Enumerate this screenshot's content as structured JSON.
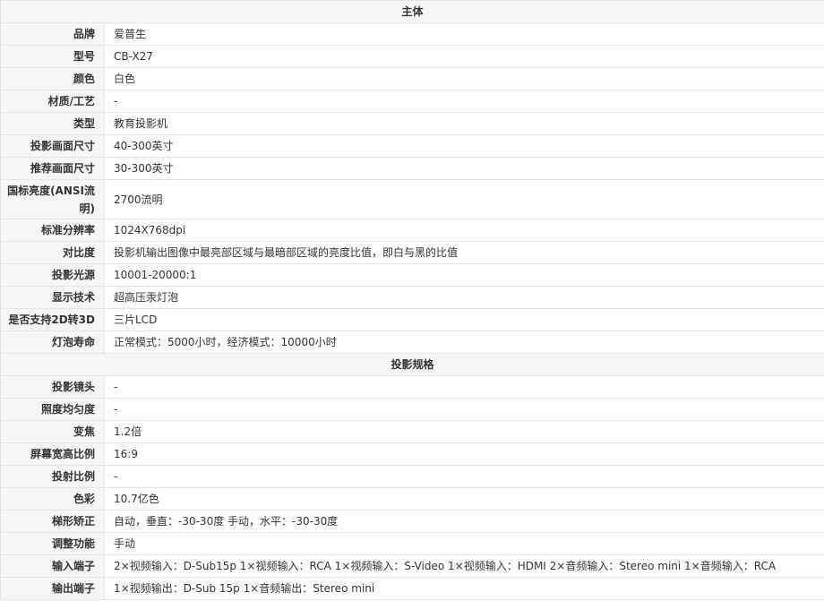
{
  "sections": [
    {
      "title": "主体",
      "rows": [
        {
          "label": "品牌",
          "value": "爱普生"
        },
        {
          "label": "型号",
          "value": "CB-X27"
        },
        {
          "label": "颜色",
          "value": "白色"
        },
        {
          "label": "材质/工艺",
          "value": "-"
        },
        {
          "label": "类型",
          "value": "教育投影机"
        },
        {
          "label": "投影画面尺寸",
          "value": "40-300英寸"
        },
        {
          "label": "推荐画面尺寸",
          "value": "30-300英寸"
        },
        {
          "label": "国标亮度(ANSI流明)",
          "value": "2700流明"
        },
        {
          "label": "标准分辨率",
          "value": "1024X768dpi"
        },
        {
          "label": "对比度",
          "value": "投影机输出图像中最亮部区域与最暗部区域的亮度比值，即白与黑的比值"
        },
        {
          "label": "投影光源",
          "value": "10001-20000:1"
        },
        {
          "label": "显示技术",
          "value": "超高压汞灯泡"
        },
        {
          "label": "是否支持2D转3D",
          "value": "三片LCD"
        },
        {
          "label": "灯泡寿命",
          "value": "正常模式：5000小时，经济模式：10000小时"
        }
      ]
    },
    {
      "title": "投影规格",
      "rows": [
        {
          "label": "投影镜头",
          "value": "-"
        },
        {
          "label": "照度均匀度",
          "value": "-"
        },
        {
          "label": "变焦",
          "value": "1.2倍"
        },
        {
          "label": "屏幕宽高比例",
          "value": "16:9"
        },
        {
          "label": "投射比例",
          "value": "-"
        },
        {
          "label": "色彩",
          "value": "10.7亿色"
        },
        {
          "label": "梯形矫正",
          "value": "自动，垂直：-30-30度 手动，水平：-30-30度"
        },
        {
          "label": "调整功能",
          "value": "手动"
        },
        {
          "label": "输入端子",
          "value": "2×视频输入：D-Sub15p 1×视频输入：RCA 1×视频输入：S-Video 1×视频输入：HDMI 2×音频输入：Stereo mini 1×音频输入：RCA"
        },
        {
          "label": "输出端子",
          "value": "1×视频输出：D-Sub 15p 1×音频输出：Stereo mini"
        }
      ]
    }
  ]
}
